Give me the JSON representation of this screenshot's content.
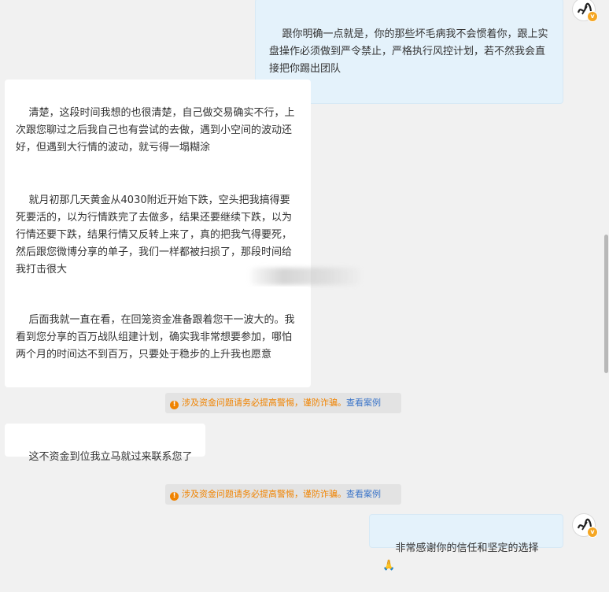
{
  "messages": {
    "m1": "跟你明确一点就是，你的那些坏毛病我不会惯着你，跟上实盘操作必须做到严令禁止，严格执行风控计划，若不然我会直接把你踢出团队",
    "m2": "清楚，这段时间我想的也很清楚，自己做交易确实不行，上次跟您聊过之后我自己也有尝试的去做，遇到小空间的波动还好，但遇到大行情的波动，就亏得一塌糊涂",
    "m3": "就月初那几天黄金从4030附近开始下跌，空头把我搞得要死要活的，以为行情跌完了去做多，结果还要继续下跌，以为行情还要下跌，结果行情又反转上来了，真的把我气得要死，然后跟您微博分享的单子，我们一样都被扫损了，那段时间给我打击很大",
    "m4": "后面我就一直在看，在回笼资金准备跟着您干一波大的。我看到您分享的百万战队组建计划，确实我非常想要参加，哪怕两个月的时间达不到百万，只要处于稳步的上升我也愿意",
    "m5": "这不资金到位我立马就过来联系您了",
    "m6": "非常感谢你的信任和坚定的选择🙏"
  },
  "notice": {
    "text": "涉及资金问题请务必提高警惕，谨防诈骗。",
    "link": "查看案例",
    "icon": "warning-icon"
  },
  "colors": {
    "outgoing_bubble": "#e4f2fb",
    "incoming_bubble": "#ffffff",
    "notice_text": "#f08300",
    "link": "#3a74c8"
  }
}
